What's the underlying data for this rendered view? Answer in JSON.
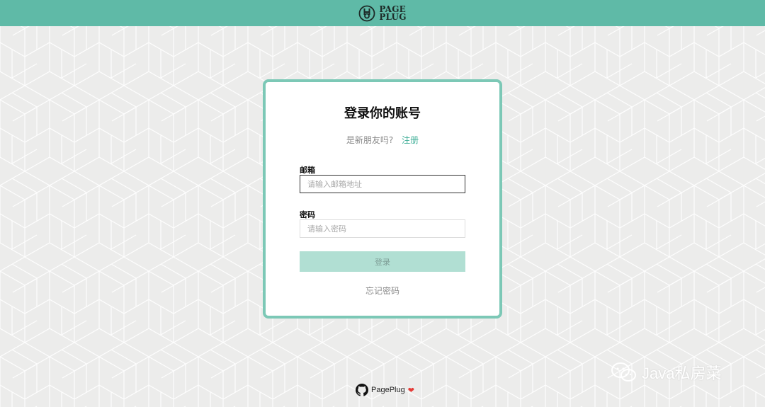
{
  "brand": {
    "logo_line1": "PAGE",
    "logo_line2": "PLUG"
  },
  "login": {
    "title": "登录你的账号",
    "signup_prompt": "是新朋友吗?",
    "signup_link": "注册",
    "email_label": "邮箱",
    "email_placeholder": "请输入邮箱地址",
    "password_label": "密码",
    "password_placeholder": "请输入密码",
    "submit_label": "登录",
    "forgot_label": "忘记密码"
  },
  "footer": {
    "project_name": "PagePlug"
  },
  "watermark": {
    "text": "Java私房菜"
  },
  "colors": {
    "header_bg": "#5fbaa7",
    "card_border": "#7cc8b6",
    "button_bg": "#b1dfd3",
    "link": "#3fae97",
    "page_bg": "#ececeb"
  },
  "icons": [
    "pageplug-logo-icon",
    "github-icon",
    "heart-icon",
    "wechat-icon"
  ]
}
